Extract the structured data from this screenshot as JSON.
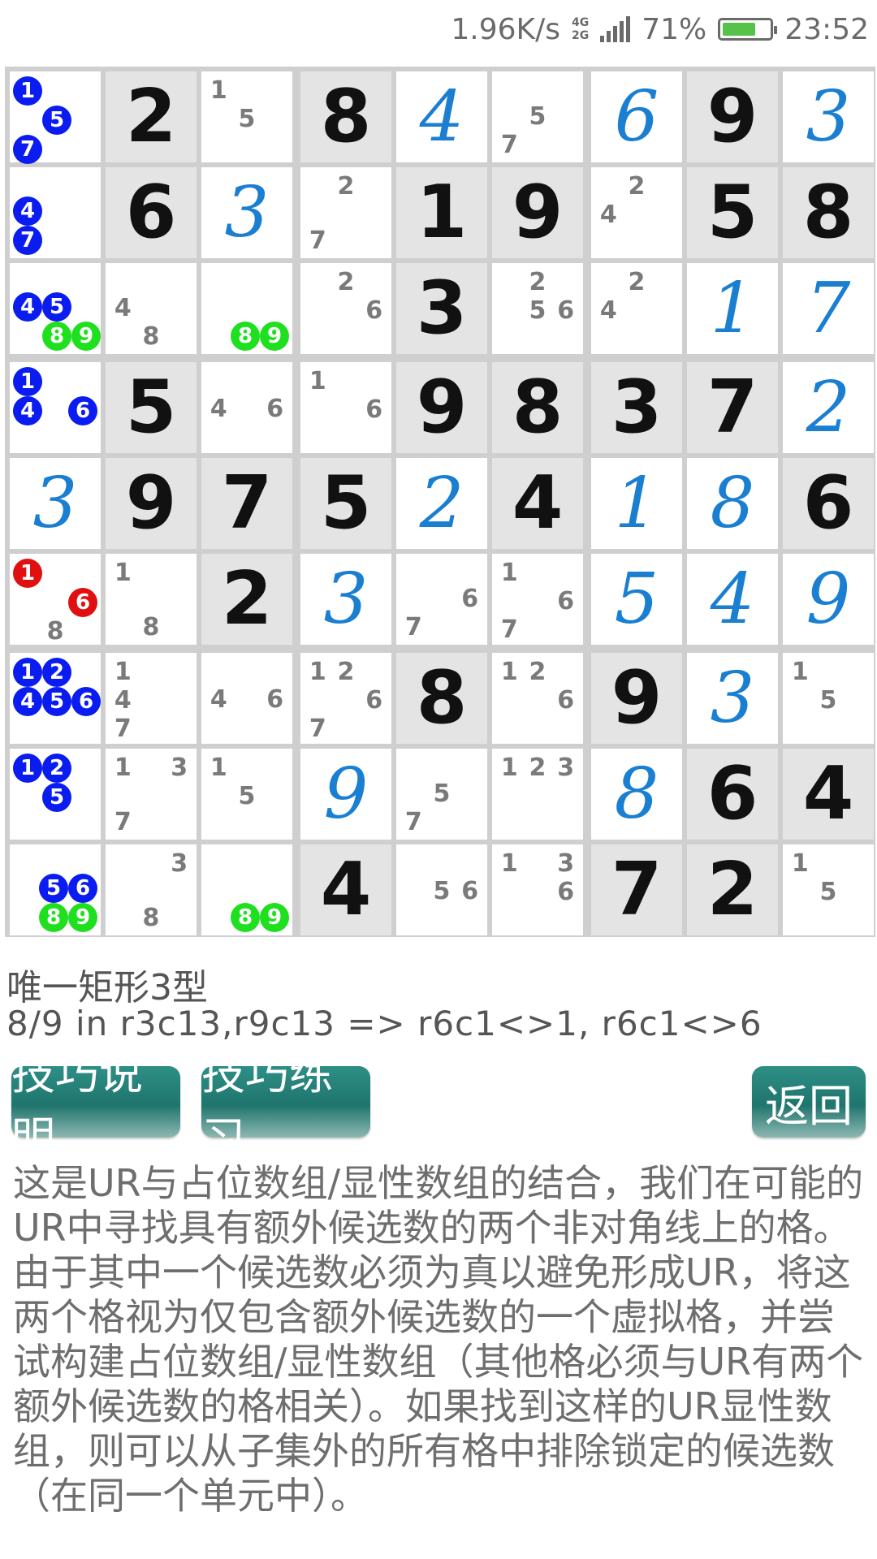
{
  "status_bar": {
    "net_speed": "1.96K/s",
    "net_types": [
      "4G",
      "2G"
    ],
    "battery_percent": "71%",
    "battery_level": 0.71,
    "time": "23:52"
  },
  "colors": {
    "given_bg": "#e4e4e4",
    "user_digit": "#1a7fd1",
    "cand_blue": "#0a1cf0",
    "cand_red": "#e01010",
    "cand_green": "#1fe01f",
    "button": "#1f756d"
  },
  "grid": [
    [
      {
        "c": [
          [
            "1",
            "b"
          ],
          [
            "5",
            "b"
          ],
          [
            "7",
            "b"
          ]
        ]
      },
      {
        "v": "2",
        "t": "g"
      },
      {
        "c": [
          [
            "1",
            ""
          ],
          [
            "5",
            ""
          ]
        ]
      },
      {
        "v": "8",
        "t": "g"
      },
      {
        "v": "4",
        "t": "u"
      },
      {
        "c": [
          [
            "5",
            ""
          ],
          [
            "7",
            ""
          ]
        ]
      },
      {
        "v": "6",
        "t": "u"
      },
      {
        "v": "9",
        "t": "g"
      },
      {
        "v": "3",
        "t": "u"
      }
    ],
    [
      {
        "c": [
          [
            "4",
            "b"
          ],
          [
            "7",
            "b"
          ]
        ]
      },
      {
        "v": "6",
        "t": "g"
      },
      {
        "v": "3",
        "t": "u"
      },
      {
        "c": [
          [
            "2",
            ""
          ],
          [
            "7",
            ""
          ]
        ]
      },
      {
        "v": "1",
        "t": "g"
      },
      {
        "v": "9",
        "t": "g"
      },
      {
        "c": [
          [
            "2",
            ""
          ],
          [
            "4",
            ""
          ]
        ]
      },
      {
        "v": "5",
        "t": "g"
      },
      {
        "v": "8",
        "t": "g"
      }
    ],
    [
      {
        "c": [
          [
            "4",
            "b"
          ],
          [
            "5",
            "b"
          ],
          [
            "8",
            "g"
          ],
          [
            "9",
            "g"
          ]
        ]
      },
      {
        "c": [
          [
            "4",
            ""
          ],
          [
            "8",
            ""
          ]
        ]
      },
      {
        "c": [
          [
            "8",
            "g"
          ],
          [
            "9",
            "g"
          ]
        ]
      },
      {
        "c": [
          [
            "2",
            ""
          ],
          [
            "6",
            ""
          ]
        ]
      },
      {
        "v": "3",
        "t": "g"
      },
      {
        "c": [
          [
            "2",
            ""
          ],
          [
            "5",
            ""
          ],
          [
            "6",
            ""
          ]
        ]
      },
      {
        "c": [
          [
            "2",
            ""
          ],
          [
            "4",
            ""
          ]
        ]
      },
      {
        "v": "1",
        "t": "u"
      },
      {
        "v": "7",
        "t": "u"
      }
    ],
    [
      {
        "c": [
          [
            "1",
            "b"
          ],
          [
            "4",
            "b"
          ],
          [
            "6",
            "b"
          ]
        ]
      },
      {
        "v": "5",
        "t": "g"
      },
      {
        "c": [
          [
            "4",
            ""
          ],
          [
            "6",
            ""
          ]
        ]
      },
      {
        "c": [
          [
            "1",
            ""
          ],
          [
            "6",
            ""
          ]
        ]
      },
      {
        "v": "9",
        "t": "g"
      },
      {
        "v": "8",
        "t": "g"
      },
      {
        "v": "3",
        "t": "g"
      },
      {
        "v": "7",
        "t": "g"
      },
      {
        "v": "2",
        "t": "u"
      }
    ],
    [
      {
        "v": "3",
        "t": "u"
      },
      {
        "v": "9",
        "t": "g"
      },
      {
        "v": "7",
        "t": "g"
      },
      {
        "v": "5",
        "t": "g"
      },
      {
        "v": "2",
        "t": "u"
      },
      {
        "v": "4",
        "t": "g"
      },
      {
        "v": "1",
        "t": "u"
      },
      {
        "v": "8",
        "t": "u"
      },
      {
        "v": "6",
        "t": "g"
      }
    ],
    [
      {
        "c": [
          [
            "1",
            "r"
          ],
          [
            "6",
            "r"
          ],
          [
            "8",
            ""
          ]
        ]
      },
      {
        "c": [
          [
            "1",
            ""
          ],
          [
            "8",
            ""
          ]
        ]
      },
      {
        "v": "2",
        "t": "g"
      },
      {
        "v": "3",
        "t": "u"
      },
      {
        "c": [
          [
            "6",
            ""
          ],
          [
            "7",
            ""
          ]
        ]
      },
      {
        "c": [
          [
            "1",
            ""
          ],
          [
            "6",
            ""
          ],
          [
            "7",
            ""
          ]
        ]
      },
      {
        "v": "5",
        "t": "u"
      },
      {
        "v": "4",
        "t": "u"
      },
      {
        "v": "9",
        "t": "u"
      }
    ],
    [
      {
        "c": [
          [
            "1",
            "b"
          ],
          [
            "2",
            "b"
          ],
          [
            "4",
            "b"
          ],
          [
            "5",
            "b"
          ],
          [
            "6",
            "b"
          ]
        ]
      },
      {
        "c": [
          [
            "1",
            ""
          ],
          [
            "4",
            ""
          ],
          [
            "7",
            ""
          ]
        ]
      },
      {
        "c": [
          [
            "4",
            ""
          ],
          [
            "6",
            ""
          ]
        ]
      },
      {
        "c": [
          [
            "1",
            ""
          ],
          [
            "2",
            ""
          ],
          [
            "6",
            ""
          ],
          [
            "7",
            ""
          ]
        ]
      },
      {
        "v": "8",
        "t": "g"
      },
      {
        "c": [
          [
            "1",
            ""
          ],
          [
            "2",
            ""
          ],
          [
            "6",
            ""
          ]
        ]
      },
      {
        "v": "9",
        "t": "g"
      },
      {
        "v": "3",
        "t": "u"
      },
      {
        "c": [
          [
            "1",
            ""
          ],
          [
            "5",
            ""
          ]
        ]
      }
    ],
    [
      {
        "c": [
          [
            "1",
            "b"
          ],
          [
            "2",
            "b"
          ],
          [
            "5",
            "b"
          ]
        ]
      },
      {
        "c": [
          [
            "1",
            ""
          ],
          [
            "3",
            ""
          ],
          [
            "7",
            ""
          ]
        ]
      },
      {
        "c": [
          [
            "1",
            ""
          ],
          [
            "5",
            ""
          ]
        ]
      },
      {
        "v": "9",
        "t": "u"
      },
      {
        "c": [
          [
            "5",
            ""
          ],
          [
            "7",
            ""
          ]
        ]
      },
      {
        "c": [
          [
            "1",
            ""
          ],
          [
            "2",
            ""
          ],
          [
            "3",
            ""
          ]
        ]
      },
      {
        "v": "8",
        "t": "u"
      },
      {
        "v": "6",
        "t": "g"
      },
      {
        "v": "4",
        "t": "g"
      }
    ],
    [
      {
        "c": [
          [
            "5",
            "b"
          ],
          [
            "6",
            "b"
          ],
          [
            "8",
            "g"
          ],
          [
            "9",
            "g"
          ]
        ]
      },
      {
        "c": [
          [
            "3",
            ""
          ],
          [
            "8",
            ""
          ]
        ]
      },
      {
        "c": [
          [
            "8",
            "g"
          ],
          [
            "9",
            "g"
          ]
        ]
      },
      {
        "v": "4",
        "t": "g"
      },
      {
        "c": [
          [
            "5",
            ""
          ],
          [
            "6",
            ""
          ]
        ]
      },
      {
        "c": [
          [
            "1",
            ""
          ],
          [
            "3",
            ""
          ],
          [
            "6",
            ""
          ]
        ]
      },
      {
        "v": "7",
        "t": "g"
      },
      {
        "v": "2",
        "t": "g"
      },
      {
        "c": [
          [
            "1",
            ""
          ],
          [
            "5",
            ""
          ]
        ]
      }
    ]
  ],
  "technique": {
    "title": "唯一矩形3型",
    "description": "8/9 in r3c13,r9c13 => r6c1<>1, r6c1<>6"
  },
  "buttons": {
    "explain": "技巧说明",
    "practice": "技巧练习",
    "back": "返回"
  },
  "explanation": "这是UR与占位数组/显性数组的结合，我们在可能的UR中寻找具有额外候选数的两个非对角线上的格。由于其中一个候选数必须为真以避免形成UR，将这两个格视为仅包含额外候选数的一个虚拟格，并尝试构建占位数组/显性数组（其他格必须与UR有两个额外候选数的格相关）。如果找到这样的UR显性数组，则可以从子集外的所有格中排除锁定的候选数（在同一个单元中）。"
}
